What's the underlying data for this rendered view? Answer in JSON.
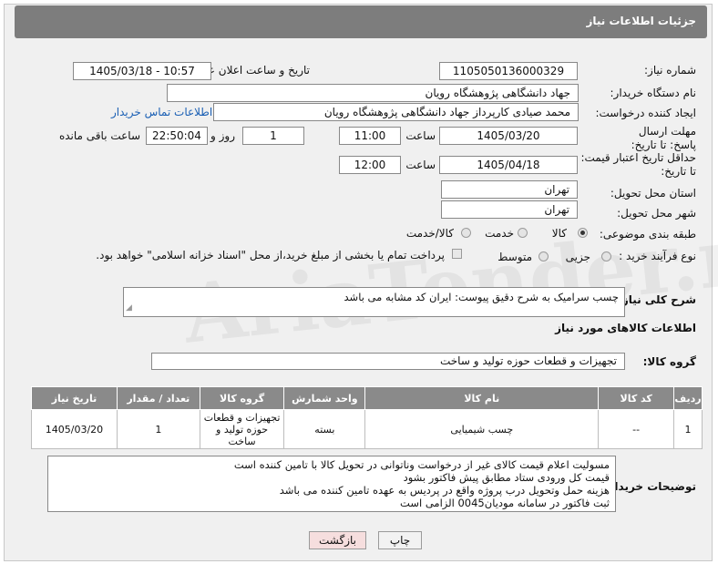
{
  "title": "جزئیات اطلاعات نیاز",
  "fields": {
    "need_number_label": "شماره نیاز:",
    "need_number": "1105050136000329",
    "announce_label": "تاریخ و ساعت اعلان عمومی:",
    "announce_value": "1405/03/18 - 10:57",
    "buyer_org_label": "نام دستگاه خریدار:",
    "buyer_org": "جهاد دانشگاهی پژوهشگاه رویان",
    "creator_label": "ایجاد کننده درخواست:",
    "creator": "محمد صیادی کارپرداز جهاد دانشگاهی پژوهشگاه رویان",
    "contact_link": "اطلاعات تماس خریدار",
    "reply_deadline_label": "مهلت ارسال پاسخ: تا تاریخ:",
    "reply_date": "1405/03/20",
    "time_label": "ساعت",
    "reply_time": "11:00",
    "days_value": "1",
    "days_label": "روز و",
    "remaining_time": "22:50:04",
    "remaining_label": "ساعت باقی مانده",
    "validity_label": "حداقل تاریخ اعتبار قیمت: تا تاریخ:",
    "validity_date": "1405/04/18",
    "validity_time": "12:00",
    "province_label": "استان محل تحویل:",
    "province": "تهران",
    "city_label": "شهر محل تحویل:",
    "city": "تهران",
    "category_label": "طبقه بندی موضوعی:",
    "category_options": [
      "کالا",
      "خدمت",
      "کالا/خدمت"
    ],
    "process_label": "نوع فرآیند خرید :",
    "process_options": [
      "جزیی",
      "متوسط"
    ],
    "payment_note": "پرداخت تمام یا بخشی از مبلغ خرید،از محل \"اسناد خزانه اسلامی\" خواهد بود."
  },
  "general_desc_label": "شرح کلی نیاز:",
  "general_desc": "چسب سرامیک به شرح دقیق پیوست: ایران کد مشابه می باشد",
  "goods_info_title": "اطلاعات کالاهای مورد نیاز",
  "goods_group_label": "گروه کالا:",
  "goods_group": "تجهیزات و قطعات حوزه تولید و ساخت",
  "table": {
    "headers": [
      "ردیف",
      "کد کالا",
      "نام کالا",
      "واحد شمارش",
      "گروه کالا",
      "تعداد / مقدار",
      "تاریخ نیاز"
    ],
    "rows": [
      [
        "1",
        "--",
        "چسب شیمیایی",
        "بسته",
        "تجهیزات و قطعات حوزه تولید و ساخت",
        "1",
        "1405/03/20"
      ]
    ]
  },
  "buyer_notes_label": "توضیحات خریدار:",
  "buyer_notes": [
    "مسولیت اعلام  قیمت کالای غیر از درخواست وناتوانی در تحویل کالا با تامین کننده است",
    "قیمت کل ورودی ستاد مطابق پیش فاکتور بشود",
    "هزینه حمل وتحویل درب پروژه واقع در پردیس به عهده تامین کننده می باشد",
    "ثبت فاکتور در سامانه مودیان0045 الزامی است"
  ],
  "buttons": {
    "print": "چاپ",
    "back": "بازگشت"
  },
  "watermark": "AriaTender.net",
  "colors": {
    "titlebar": "#7d7d7d",
    "table_header": "#8a8a8a",
    "link": "#1a5fb4",
    "back_button_bg": "#f6dede"
  }
}
